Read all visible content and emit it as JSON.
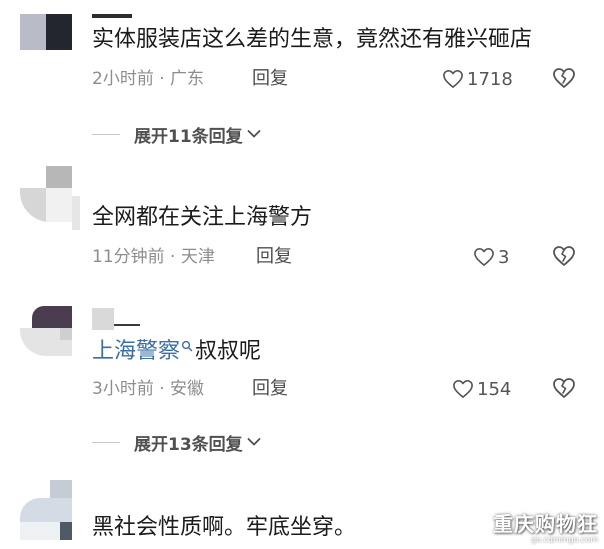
{
  "comments": [
    {
      "text": "实体服装店这么差的生意，竟然还有雅兴砸店",
      "meta": "2小时前 · 广东",
      "reply_label": "回复",
      "likes": "1718",
      "expand_label": "展开11条回复"
    },
    {
      "text": "全网都在关注上海警方",
      "meta": "11分钟前 · 天津",
      "reply_label": "回复",
      "likes": "3"
    },
    {
      "mention": "上海警察",
      "text": "叔叔呢",
      "meta": "3小时前 · 安徽",
      "reply_label": "回复",
      "likes": "154",
      "expand_label": "展开13条回复"
    },
    {
      "text": "黑社会性质啊。牢底坐穿。"
    }
  ],
  "watermark": {
    "main": "重庆购物狂",
    "sub": "go.cqmmgo.com"
  },
  "colors": {
    "text": "#1b1b1b",
    "meta": "#8d8d8d",
    "mention": "#3a6ea8"
  },
  "icons": {
    "like": "heart-outline-icon",
    "dislike": "broken-heart-icon",
    "expand": "chevron-down-icon",
    "mention": "search-icon"
  }
}
